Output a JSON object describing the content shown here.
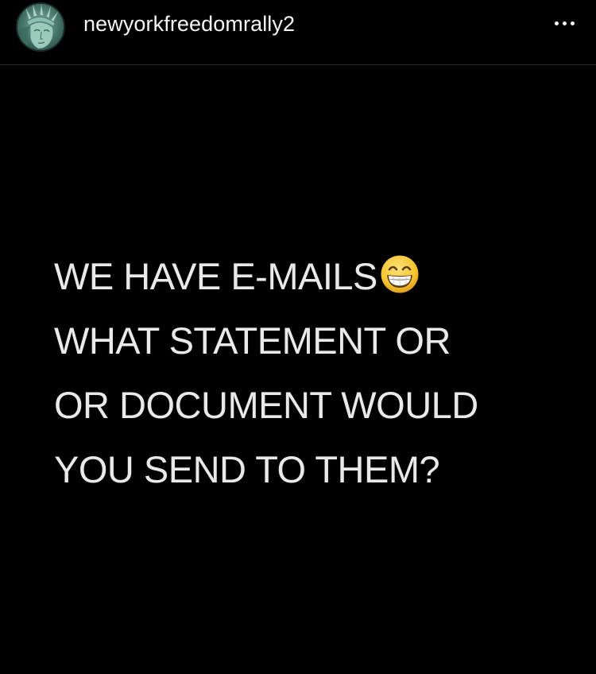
{
  "header": {
    "username": "newyorkfreedomrally2",
    "avatar_icon": "statue-of-liberty-avatar",
    "more_icon": "more-options-icon"
  },
  "post": {
    "lines": [
      "WE HAVE E-MAILS",
      "WHAT STATEMENT OR",
      "OR DOCUMENT WOULD",
      "YOU SEND TO THEM?"
    ],
    "emoji": "grinning-face-with-smiling-eyes",
    "background_color": "#000000",
    "text_color": "#e9e9e9"
  }
}
